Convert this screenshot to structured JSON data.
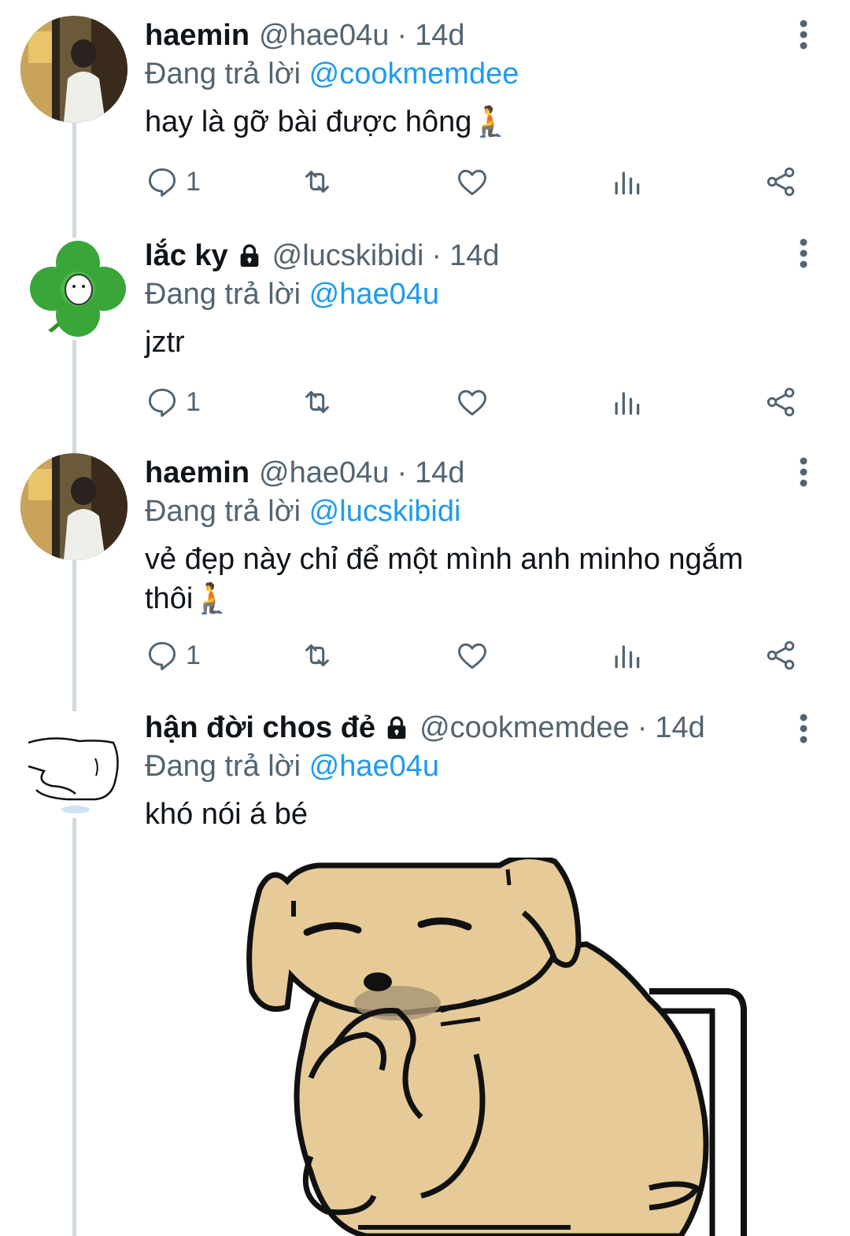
{
  "tweets": [
    {
      "name": "haemin",
      "handle": "@hae04u",
      "time": "14d",
      "replying_prefix": "Đang trả lời",
      "replying_to": "@cookmemdee",
      "text": "hay là gỡ bài được hông🧎",
      "reply_count": "1",
      "locked": false
    },
    {
      "name": "lắc ky",
      "handle": "@lucskibidi",
      "time": "14d",
      "replying_prefix": "Đang trả lời",
      "replying_to": "@hae04u",
      "text": "jztr",
      "reply_count": "1",
      "locked": true
    },
    {
      "name": "haemin",
      "handle": "@hae04u",
      "time": "14d",
      "replying_prefix": "Đang trả lời",
      "replying_to": "@lucskibidi",
      "text": "vẻ đẹp này chỉ để một mình anh minho ngắm thôi🧎",
      "reply_count": "1",
      "locked": false
    },
    {
      "name": "hận đời chos đẻ",
      "handle": "@cookmemdee",
      "time": "14d",
      "replying_prefix": "Đang trả lời",
      "replying_to": "@hae04u",
      "text": "khó nói á bé",
      "locked": true,
      "has_image": true
    }
  ],
  "separator": "·",
  "icons": [
    "more-vertical-icon",
    "reply-icon",
    "retweet-icon",
    "like-icon",
    "views-icon",
    "share-icon",
    "lock-icon"
  ],
  "colors": {
    "accent": "#1d9bf0",
    "secondary_text": "#536471",
    "text": "#0f1419",
    "thread_line": "#cfd9de"
  }
}
